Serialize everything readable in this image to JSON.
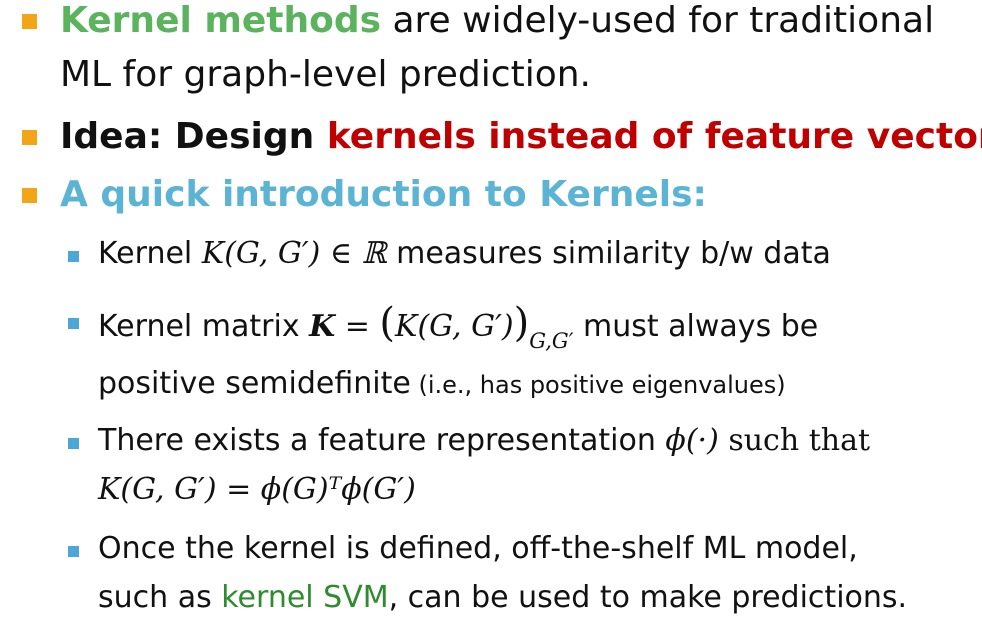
{
  "colors": {
    "bullet1": "#f2a516",
    "bullet2": "#4aa7d8",
    "green": "#5bb35e",
    "red": "#c00000",
    "blue": "#5bb4d4",
    "dark_green": "#2e8b2e"
  },
  "bullets": {
    "b1": {
      "highlight": "Kernel methods",
      "rest_line1": " are widely-used for traditional",
      "line2": "ML for graph-level prediction."
    },
    "b2": {
      "lead": "Idea: Design ",
      "highlight": "kernels instead of feature vectors"
    },
    "b3": {
      "text": "A quick introduction to Kernels:"
    }
  },
  "sub_bullets": {
    "s1": {
      "pre": "Kernel ",
      "math": "K(G, G′) ∈ ℝ",
      "post": "  measures similarity b/w data"
    },
    "s2": {
      "pre": "Kernel matrix ",
      "math_K": "K",
      "math_eq": " = ",
      "paren_open": "(",
      "math_inner": "K(G, G′)",
      "paren_close": ")",
      "subscript": "G,G′",
      "post": " must always be",
      "line2": "positive semidefinite",
      "line2_small": " (i.e., has positive eigenvalues)"
    },
    "s3": {
      "pre": "There exists a feature representation ",
      "math_phi": "ϕ(·)",
      "post": " such that",
      "line2_math": "K(G, G′) = ϕ(G)ᵀϕ(G′)"
    },
    "s4": {
      "line1": "Once the kernel is defined, off-the-shelf ML model,",
      "line2_pre": "such as ",
      "line2_highlight": "kernel SVM",
      "line2_post": ", can be used to make predictions."
    }
  }
}
